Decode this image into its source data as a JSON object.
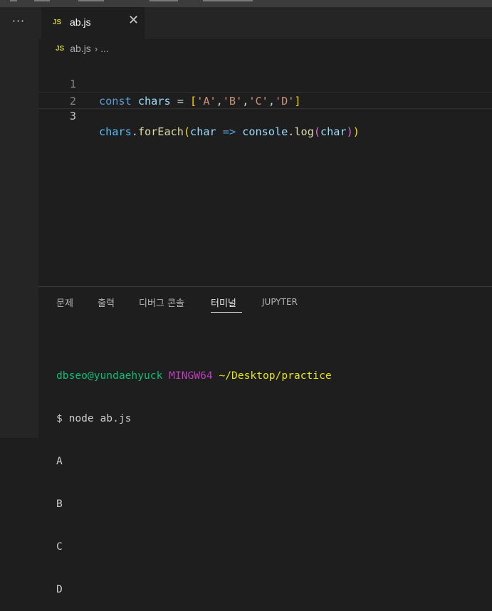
{
  "titlebar": {},
  "sidebar": {
    "more_icon": "more-horizontal-icon"
  },
  "tab": {
    "lang_badge": "JS",
    "filename": "ab.js",
    "close_icon": "close-icon"
  },
  "breadcrumb": {
    "lang_badge": "JS",
    "file": "ab.js",
    "separator": "›",
    "rest": "..."
  },
  "editor": {
    "line_numbers": [
      "1",
      "2",
      "3"
    ],
    "lines": [
      {
        "tokens": [
          {
            "text": "const",
            "kind": "keyword"
          },
          {
            "text": " ",
            "kind": "space"
          },
          {
            "text": "chars",
            "kind": "variable"
          },
          {
            "text": " = ",
            "kind": "operator"
          },
          {
            "text": "[",
            "kind": "bracket1"
          },
          {
            "text": "'A'",
            "kind": "string"
          },
          {
            "text": ",",
            "kind": "operator"
          },
          {
            "text": "'B'",
            "kind": "string"
          },
          {
            "text": ",",
            "kind": "operator"
          },
          {
            "text": "'C'",
            "kind": "string"
          },
          {
            "text": ",",
            "kind": "operator"
          },
          {
            "text": "'D'",
            "kind": "string"
          },
          {
            "text": "]",
            "kind": "bracket1"
          }
        ]
      },
      {
        "tokens": []
      },
      {
        "tokens": [
          {
            "text": "chars",
            "kind": "variable2"
          },
          {
            "text": ".",
            "kind": "operator"
          },
          {
            "text": "forEach",
            "kind": "function"
          },
          {
            "text": "(",
            "kind": "bracket1"
          },
          {
            "text": "char",
            "kind": "variable"
          },
          {
            "text": " ",
            "kind": "space"
          },
          {
            "text": "=>",
            "kind": "keyword"
          },
          {
            "text": " ",
            "kind": "space"
          },
          {
            "text": "console",
            "kind": "variable"
          },
          {
            "text": ".",
            "kind": "operator"
          },
          {
            "text": "log",
            "kind": "function"
          },
          {
            "text": "(",
            "kind": "bracket2"
          },
          {
            "text": "char",
            "kind": "variable"
          },
          {
            "text": ")",
            "kind": "bracket2"
          },
          {
            "text": ")",
            "kind": "bracket1"
          }
        ]
      }
    ]
  },
  "panel": {
    "tabs": [
      {
        "label": "문제",
        "active": false
      },
      {
        "label": "출력",
        "active": false
      },
      {
        "label": "디버그 콘솔",
        "active": false
      },
      {
        "label": "터미널",
        "active": true
      },
      {
        "label": "JUPYTER",
        "active": false
      }
    ]
  },
  "terminal": {
    "prompt_user": "dbseo@yundaehyuck",
    "prompt_system": "MINGW64",
    "prompt_dir": "~/Desktop/practice",
    "command": "$ node ab.js",
    "output": [
      "A",
      "B",
      "C",
      "D"
    ]
  },
  "colors": {
    "editor_bg": "#1e1e1e",
    "sidebar_bg": "#252526",
    "keyword": "#569cd6",
    "variable": "#9cdcfe",
    "string": "#ce9178",
    "function": "#dcdcaa",
    "bracket1": "#ffd700",
    "bracket2": "#da70d6",
    "terminal_user": "#0dbc79",
    "terminal_system": "#bc3fbc",
    "terminal_dir": "#e5e510"
  }
}
